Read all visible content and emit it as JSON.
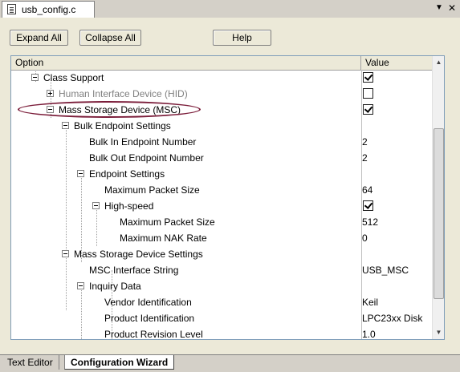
{
  "tab": {
    "file_name": "usb_config.c"
  },
  "toolbar": {
    "expand_all": "Expand All",
    "collapse_all": "Collapse All",
    "help": "Help"
  },
  "columns": {
    "option": "Option",
    "value": "Value"
  },
  "rows": [
    {
      "label": "Class Support",
      "expander": "minus",
      "value_type": "checkbox",
      "checked": true
    },
    {
      "label": "Human Interface Device (HID)",
      "expander": "plus",
      "value_type": "checkbox",
      "checked": false,
      "disabled": true
    },
    {
      "label": "Mass Storage Device (MSC)",
      "expander": "minus",
      "value_type": "checkbox",
      "checked": true,
      "highlighted": true
    },
    {
      "label": "Bulk Endpoint Settings",
      "expander": "minus",
      "value_type": "none"
    },
    {
      "label": "Bulk In Endpoint Number",
      "expander": "none",
      "value_type": "text",
      "value": "2"
    },
    {
      "label": "Bulk Out Endpoint Number",
      "expander": "none",
      "value_type": "text",
      "value": "2"
    },
    {
      "label": "Endpoint Settings",
      "expander": "minus",
      "value_type": "none"
    },
    {
      "label": "Maximum Packet Size",
      "expander": "none",
      "value_type": "text",
      "value": "64"
    },
    {
      "label": "High-speed",
      "expander": "minus",
      "value_type": "checkbox",
      "checked": true
    },
    {
      "label": "Maximum Packet Size",
      "expander": "none",
      "value_type": "text",
      "value": "512"
    },
    {
      "label": "Maximum NAK Rate",
      "expander": "none",
      "value_type": "text",
      "value": "0"
    },
    {
      "label": "Mass Storage Device Settings",
      "expander": "minus",
      "value_type": "none"
    },
    {
      "label": "MSC Interface String",
      "expander": "none",
      "value_type": "text",
      "value": "USB_MSC"
    },
    {
      "label": "Inquiry Data",
      "expander": "minus",
      "value_type": "none"
    },
    {
      "label": "Vendor Identification",
      "expander": "none",
      "value_type": "text",
      "value": "Keil"
    },
    {
      "label": "Product Identification",
      "expander": "none",
      "value_type": "text",
      "value": "LPC23xx Disk"
    },
    {
      "label": "Product Revision Level",
      "expander": "none",
      "value_type": "text",
      "value": "1.0"
    }
  ],
  "bottom_tabs": {
    "text_editor": "Text Editor",
    "configuration_wizard": "Configuration Wizard"
  },
  "colors": {
    "highlight_ellipse": "#7b1d3a",
    "disabled_text": "#808080"
  }
}
